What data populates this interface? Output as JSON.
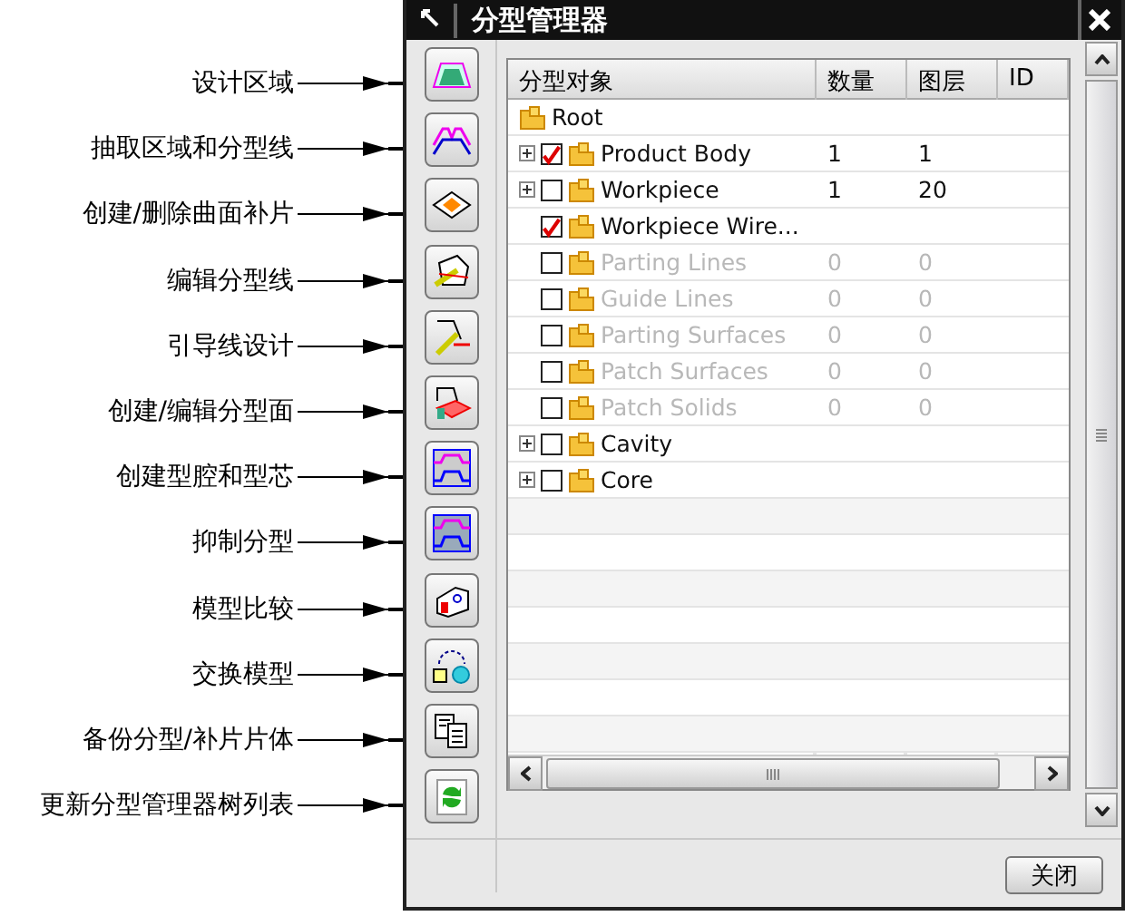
{
  "window": {
    "title": "分型管理器"
  },
  "tools": [
    {
      "label": "设计区域",
      "kind": "region"
    },
    {
      "label": "抽取区域和分型线",
      "kind": "extract"
    },
    {
      "label": "创建/删除曲面补片",
      "kind": "patch"
    },
    {
      "label": "编辑分型线",
      "kind": "editline"
    },
    {
      "label": "引导线设计",
      "kind": "guide"
    },
    {
      "label": "创建/编辑分型面",
      "kind": "surface"
    },
    {
      "label": "创建型腔和型芯",
      "kind": "cavity"
    },
    {
      "label": "抑制分型",
      "kind": "suppress"
    },
    {
      "label": "模型比较",
      "kind": "compare"
    },
    {
      "label": "交换模型",
      "kind": "swap"
    },
    {
      "label": "备份分型/补片片体",
      "kind": "backup"
    },
    {
      "label": "更新分型管理器树列表",
      "kind": "refresh"
    }
  ],
  "tree": {
    "columns": [
      "分型对象",
      "数量",
      "图层",
      "ID"
    ],
    "root": {
      "name": "Root",
      "children": [
        {
          "name": "Product Body",
          "checked": true,
          "disabled": false,
          "expanded": false,
          "count": "1",
          "layer": "1"
        },
        {
          "name": "Workpiece",
          "checked": false,
          "disabled": false,
          "expanded": false,
          "count": "1",
          "layer": "20"
        },
        {
          "name": "Workpiece Wire...",
          "checked": true,
          "disabled": false
        },
        {
          "name": "Parting Lines",
          "checked": false,
          "disabled": true,
          "count": "0",
          "layer": "0"
        },
        {
          "name": "Guide Lines",
          "checked": false,
          "disabled": true,
          "count": "0",
          "layer": "0"
        },
        {
          "name": "Parting Surfaces",
          "checked": false,
          "disabled": true,
          "count": "0",
          "layer": "0"
        },
        {
          "name": "Patch Surfaces",
          "checked": false,
          "disabled": true,
          "count": "0",
          "layer": "0"
        },
        {
          "name": "Patch Solids",
          "checked": false,
          "disabled": true,
          "count": "0",
          "layer": "0"
        },
        {
          "name": "Cavity",
          "checked": false,
          "disabled": false,
          "expanded": false
        },
        {
          "name": "Core",
          "checked": false,
          "disabled": false,
          "expanded": false
        }
      ]
    }
  },
  "buttons": [
    "关闭"
  ]
}
